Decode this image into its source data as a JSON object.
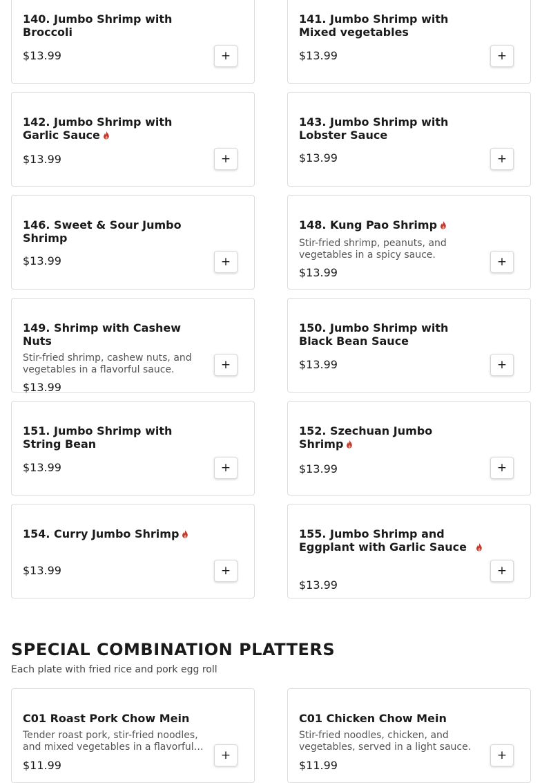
{
  "menu": {
    "items": [
      {
        "name": "140. Jumbo Shrimp with Broccoli",
        "price": "$13.99",
        "spicy": false,
        "description": ""
      },
      {
        "name": "141. Jumbo Shrimp with Mixed vegetables",
        "price": "$13.99",
        "spicy": false,
        "description": ""
      },
      {
        "name": "142. Jumbo Shrimp with Garlic Sauce",
        "price": "$13.99",
        "spicy": true,
        "description": ""
      },
      {
        "name": "143. Jumbo Shrimp with Lobster Sauce",
        "price": "$13.99",
        "spicy": false,
        "description": ""
      },
      {
        "name": "146. Sweet & Sour Jumbo Shrimp",
        "price": "$13.99",
        "spicy": false,
        "description": ""
      },
      {
        "name": "148. Kung Pao Shrimp",
        "price": "$13.99",
        "spicy": true,
        "description": "Stir-fried shrimp, peanuts, and vegetables in a spicy sauce."
      },
      {
        "name": "149. Shrimp with Cashew Nuts",
        "price": "$13.99",
        "spicy": false,
        "description": "Stir-fried shrimp, cashew nuts, and vegetables in a flavorful sauce."
      },
      {
        "name": "150. Jumbo Shrimp with Black Bean Sauce",
        "price": "$13.99",
        "spicy": false,
        "description": ""
      },
      {
        "name": "151. Jumbo Shrimp with String Bean",
        "price": "$13.99",
        "spicy": false,
        "description": ""
      },
      {
        "name": "152. Szechuan Jumbo Shrimp",
        "price": "$13.99",
        "spicy": true,
        "description": ""
      },
      {
        "name": "154. Curry Jumbo Shrimp",
        "price": "$13.99",
        "spicy": true,
        "description": ""
      },
      {
        "name": "155. Jumbo Shrimp and Eggplant with Garlic Sauce",
        "price": "$13.99",
        "spicy": true,
        "description": ""
      }
    ],
    "add_label": "+",
    "spicy_icon": "flame-icon",
    "spicy_color": "#c0392b"
  },
  "section": {
    "title": "SPECIAL COMBINATION PLATTERS",
    "subtitle": "Each plate with fried rice and pork egg roll",
    "items": [
      {
        "name": "C01 Roast Pork Chow Mein",
        "price": "$11.99",
        "spicy": false,
        "description": "Tender roast pork, stir-fried noodles, and mixed vegetables in a flavorful…"
      },
      {
        "name": "C01 Chicken Chow Mein",
        "price": "$11.99",
        "spicy": false,
        "description": "Stir-fried noodles, chicken, and vegetables, served in a light sauce."
      }
    ]
  }
}
